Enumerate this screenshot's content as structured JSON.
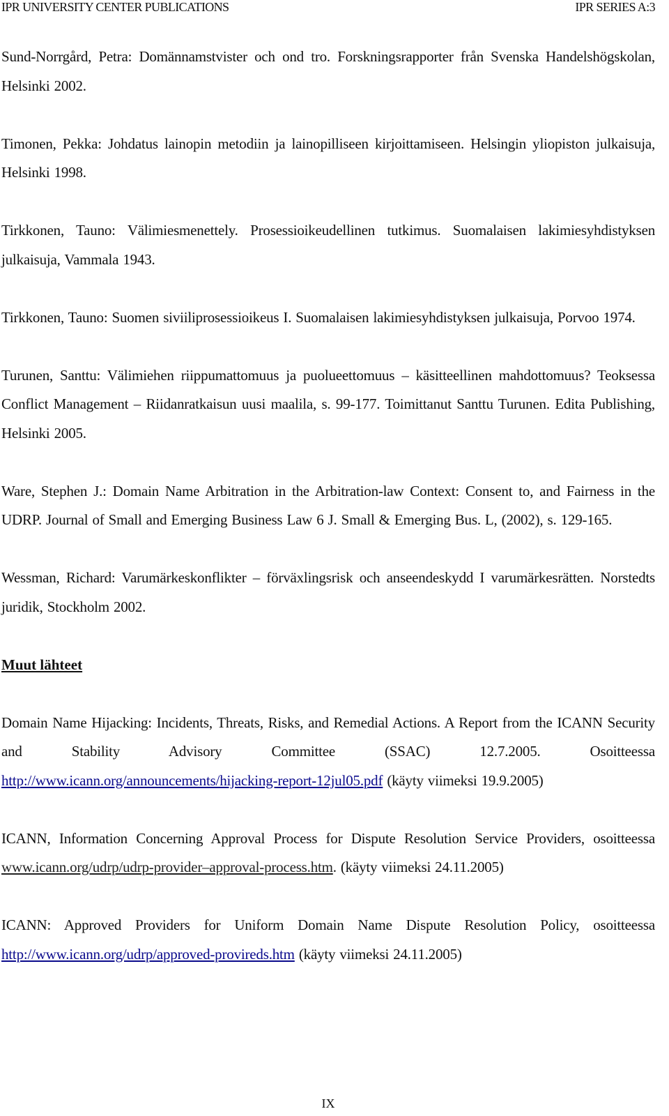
{
  "header": {
    "left": "IPR UNIVERSITY CENTER PUBLICATIONS",
    "right": "IPR SERIES A:3"
  },
  "references": [
    {
      "text": "Sund-Norrgård, Petra: Domännamstvister och ond tro. Forskningsrapporter från Svenska Handelshögskolan, Helsinki 2002."
    },
    {
      "text": "Timonen, Pekka: Johdatus lainopin metodiin ja lainopilliseen kirjoittamiseen. Helsingin yliopiston julkaisuja, Helsinki 1998."
    },
    {
      "text": "Tirkkonen, Tauno: Välimiesmenettely. Prosessioikeudellinen tutkimus. Suomalaisen lakimiesyhdistyksen julkaisuja, Vammala 1943."
    },
    {
      "text": "Tirkkonen, Tauno: Suomen siviiliprosessioikeus I. Suomalaisen lakimiesyhdistyksen julkaisuja, Porvoo 1974."
    },
    {
      "text": "Turunen, Santtu: Välimiehen riippumattomuus ja puolueettomuus – käsitteellinen mahdottomuus? Teoksessa Conflict Management – Riidanratkaisun uusi maalila, s. 99-177. Toimittanut Santtu Turunen. Edita Publishing, Helsinki 2005."
    },
    {
      "text": "Ware, Stephen J.: Domain Name Arbitration in the Arbitration-law Context: Consent to, and Fairness in the UDRP. Journal of Small and Emerging Business Law 6 J. Small & Emerging Bus. L, (2002), s. 129-165."
    },
    {
      "text": "Wessman, Richard: Varumärkeskonflikter – förväxlingsrisk och anseendeskydd I varumärkesrätten. Norstedts juridik, Stockholm 2002."
    }
  ],
  "other_sources": {
    "title": "Muut lähteet",
    "items": [
      {
        "before": "Domain Name Hijacking: Incidents, Threats, Risks, and Remedial Actions. A Report from the ICANN Security and Stability Advisory Committee (SSAC) 12.7.2005. Osoitteessa ",
        "link": "http://www.icann.org/announcements/hijacking-report-12jul05.pdf",
        "after": " (käyty viimeksi 19.9.2005)"
      },
      {
        "before": "ICANN, Information Concerning Approval Process for Dispute Resolution Service Providers, osoitteessa ",
        "link": "www.icann.org/udrp/udrp-provider–approval-process.htm",
        "after": ". (käyty viimeksi 24.11.2005)"
      },
      {
        "before": "ICANN: Approved Providers for Uniform Domain Name Dispute Resolution Policy, osoitteessa ",
        "link": "http://www.icann.org/udrp/approved-provireds.htm",
        "after": " (käyty viimeksi 24.11.2005)"
      }
    ]
  },
  "colors": {
    "link": "#0a0a8c",
    "text": "#111111"
  },
  "page_number": "IX"
}
